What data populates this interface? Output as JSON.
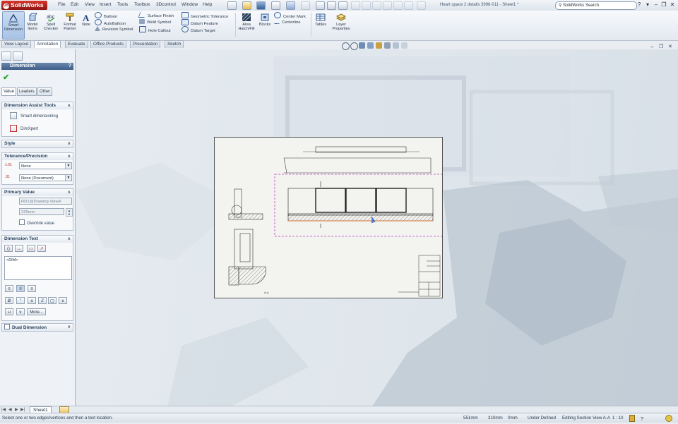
{
  "app": {
    "name": "SolidWorks",
    "document_title": "Heart space 2 details 3998-011 - Sheet1 *"
  },
  "menu": [
    "File",
    "Edit",
    "View",
    "Insert",
    "Tools",
    "Toolbox",
    "3Dcontrol",
    "Window",
    "Help"
  ],
  "search": {
    "placeholder": "SolidWorks Search"
  },
  "commands": {
    "large": [
      {
        "label": "Smart Dimension",
        "icon": "smart-dimension-icon",
        "active": true
      },
      {
        "label": "Model Items",
        "icon": "model-items-icon"
      },
      {
        "label": "Spell Checker",
        "icon": "spell-checker-icon"
      },
      {
        "label": "Format Painter",
        "icon": "format-painter-icon"
      },
      {
        "label": "Note",
        "icon": "note-icon"
      }
    ],
    "small_col1": [
      "Balloon",
      "AutoBalloon",
      "Revision Symbol"
    ],
    "small_col2": [
      "Surface Finish",
      "Weld Symbol",
      "Hole Callout"
    ],
    "small_col3": [
      "Geometric Tolerance",
      "Datum Feature",
      "Datum Target"
    ],
    "area_hatch": "Area Hatch/Fill",
    "blocks": "Blocks",
    "small_col4": [
      "Center Mark",
      "Centerline"
    ],
    "tables": "Tables",
    "layer_properties": "Layer Properties"
  },
  "tabs": [
    "View Layout",
    "Annotation",
    "Evaluate",
    "Office Products",
    "Presentation",
    "Sketch"
  ],
  "active_tab": "Annotation",
  "property_manager": {
    "title": "Dimension",
    "help": "?",
    "subtabs": [
      "Value",
      "Leaders",
      "Other"
    ],
    "groups": {
      "assist": {
        "title": "Dimension Assist Tools",
        "items": [
          "Smart dimensioning",
          "DimXpert"
        ]
      },
      "style": {
        "title": "Style"
      },
      "tolerance": {
        "title": "Tolerance/Precision",
        "tol_value": "None",
        "precision_value": "None (Document)"
      },
      "primary": {
        "title": "Primary Value",
        "name_value": "RD1@Drawing View4",
        "value": "225mm",
        "override": "Override value"
      },
      "dimtext": {
        "title": "Dimension Text",
        "text": "<DIM>",
        "more": "More..."
      },
      "dual": {
        "title": "Dual Dimension"
      }
    }
  },
  "sheet_tab": "Sheet1",
  "status": {
    "message": "Select one or two edges/vertices and then a text location.",
    "x": "551mm",
    "y": "310mm",
    "z": "0mm",
    "definition": "Under Defined",
    "editing": "Editing Section View A-A",
    "scale": "1 : 10"
  },
  "drawing": {
    "scale_note": "A-A"
  },
  "colors": {
    "accent": "#3f5f8a",
    "selection": "#c040c0",
    "logo": "#c4271e"
  }
}
